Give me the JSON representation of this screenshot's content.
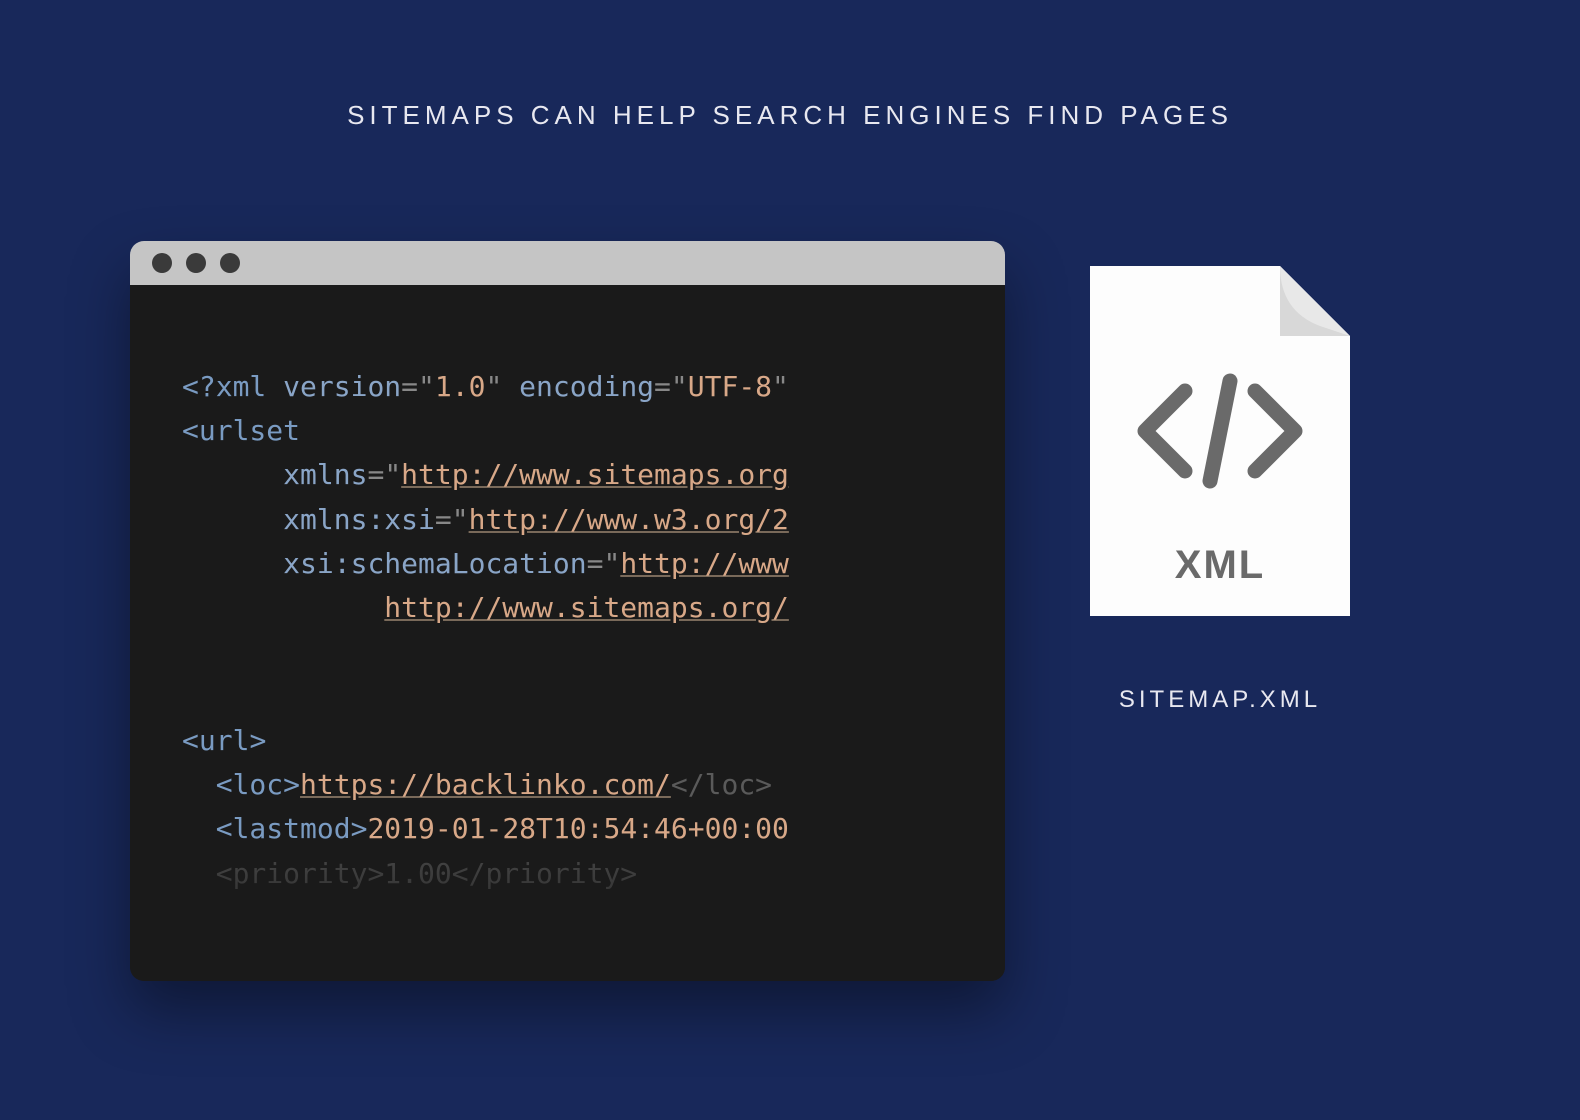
{
  "title": "SITEMAPS CAN HELP SEARCH ENGINES FIND PAGES",
  "file": {
    "label": "SITEMAP.XML",
    "type": "XML"
  },
  "code": {
    "xml_open": "<?",
    "xml_tag": "xml",
    "version_attr": " version",
    "version_val": "1.0",
    "encoding_attr": " encoding",
    "encoding_val": "UTF-8",
    "urlset_tag": "urlset",
    "xmlns_attr": "xmlns",
    "xmlns_val": "http://www.sitemaps.org",
    "xmlns_xsi_attr": "xmlns:xsi",
    "xmlns_xsi_val": "http://www.w3.org/2",
    "xsi_schema_attr": "xsi:schemaLocation",
    "xsi_schema_val": "http://www",
    "schema_line2": "http://www.sitemaps.org/",
    "url_tag": "url",
    "loc_tag": "loc",
    "loc_val": "https://backlinko.com/",
    "lastmod_tag": "lastmod",
    "lastmod_val": "2019-01-28T10:54:46+00:00",
    "priority_tag": "priority",
    "priority_val": "1.00"
  }
}
